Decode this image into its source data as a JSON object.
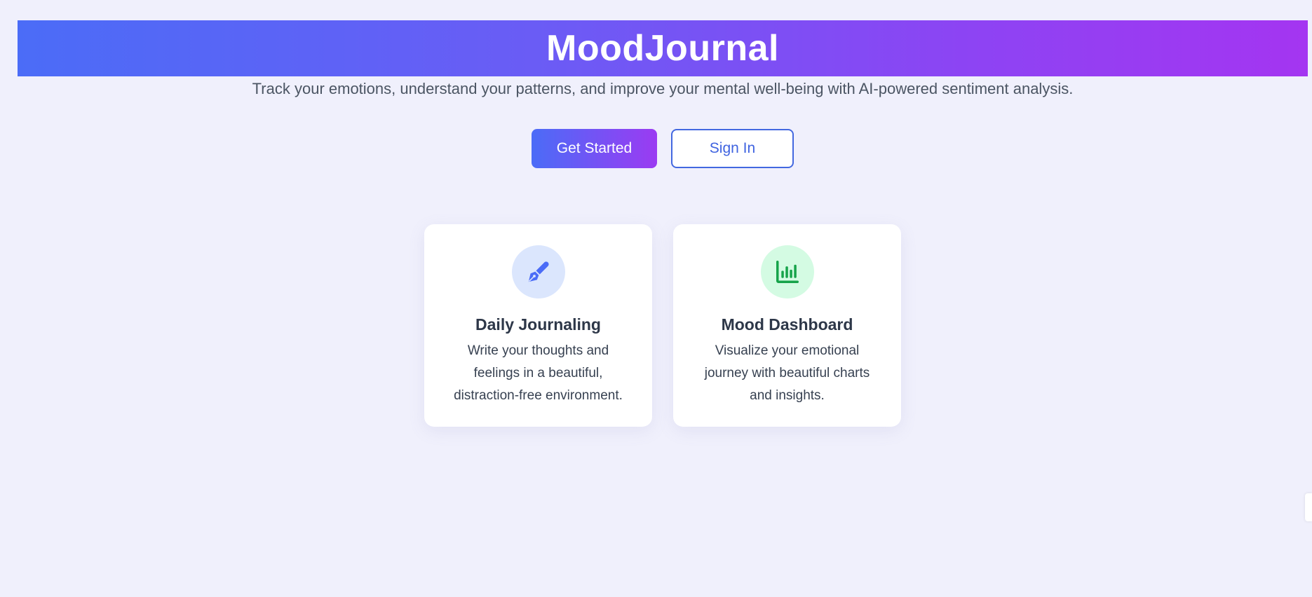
{
  "header": {
    "title": "MoodJournal"
  },
  "hero": {
    "subtitle": "Track your emotions, understand your patterns, and improve your mental well-being with AI-powered sentiment analysis."
  },
  "actions": {
    "get_started": "Get Started",
    "sign_in": "Sign In"
  },
  "features": [
    {
      "icon": "pen-nib-icon",
      "title": "Daily Journaling",
      "description": "Write your thoughts and feelings in a beautiful, distraction-free environment."
    },
    {
      "icon": "bar-chart-icon",
      "title": "Mood Dashboard",
      "description": "Visualize your emotional journey with beautiful charts and insights."
    }
  ],
  "colors": {
    "background": "#f0f0fc",
    "gradient_start": "#4b6cf7",
    "gradient_end": "#a435f1",
    "accent_blue": "#4368e0",
    "accent_green": "#16a34a"
  }
}
